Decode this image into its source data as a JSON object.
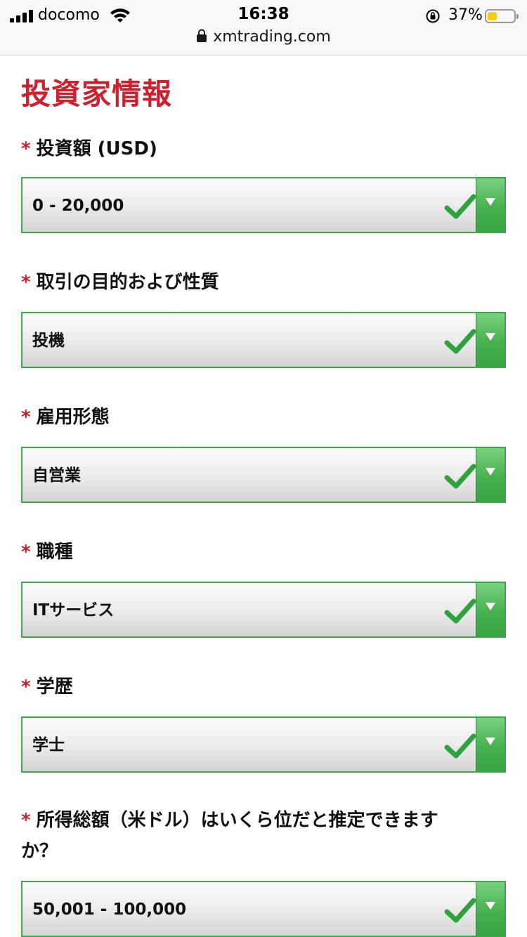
{
  "status_bar": {
    "carrier": "docomo",
    "time": "16:38",
    "battery_percent": "37%",
    "battery_level": 0.37,
    "url": "xmtrading.com"
  },
  "page": {
    "title": "投資家情報"
  },
  "fields": [
    {
      "label": "投資額 (USD)",
      "required": "*",
      "value": "0 - 20,000"
    },
    {
      "label": "取引の目的および性質",
      "required": "*",
      "value": "投機"
    },
    {
      "label": "雇用形態",
      "required": "*",
      "value": "自営業"
    },
    {
      "label": "職種",
      "required": "*",
      "value": "ITサービス"
    },
    {
      "label": "学歴",
      "required": "*",
      "value": "学士"
    },
    {
      "label_line1": "所得総額（米ドル）はいくら位だと推定できます",
      "label_line2": "か？",
      "required": "*",
      "value": "50,001 - 100,000"
    }
  ],
  "colors": {
    "accent_red": "#d0202e",
    "valid_green": "#3aaa48"
  },
  "icons": {
    "valid": "checkmark-icon",
    "dropdown": "triangle-down-icon"
  }
}
